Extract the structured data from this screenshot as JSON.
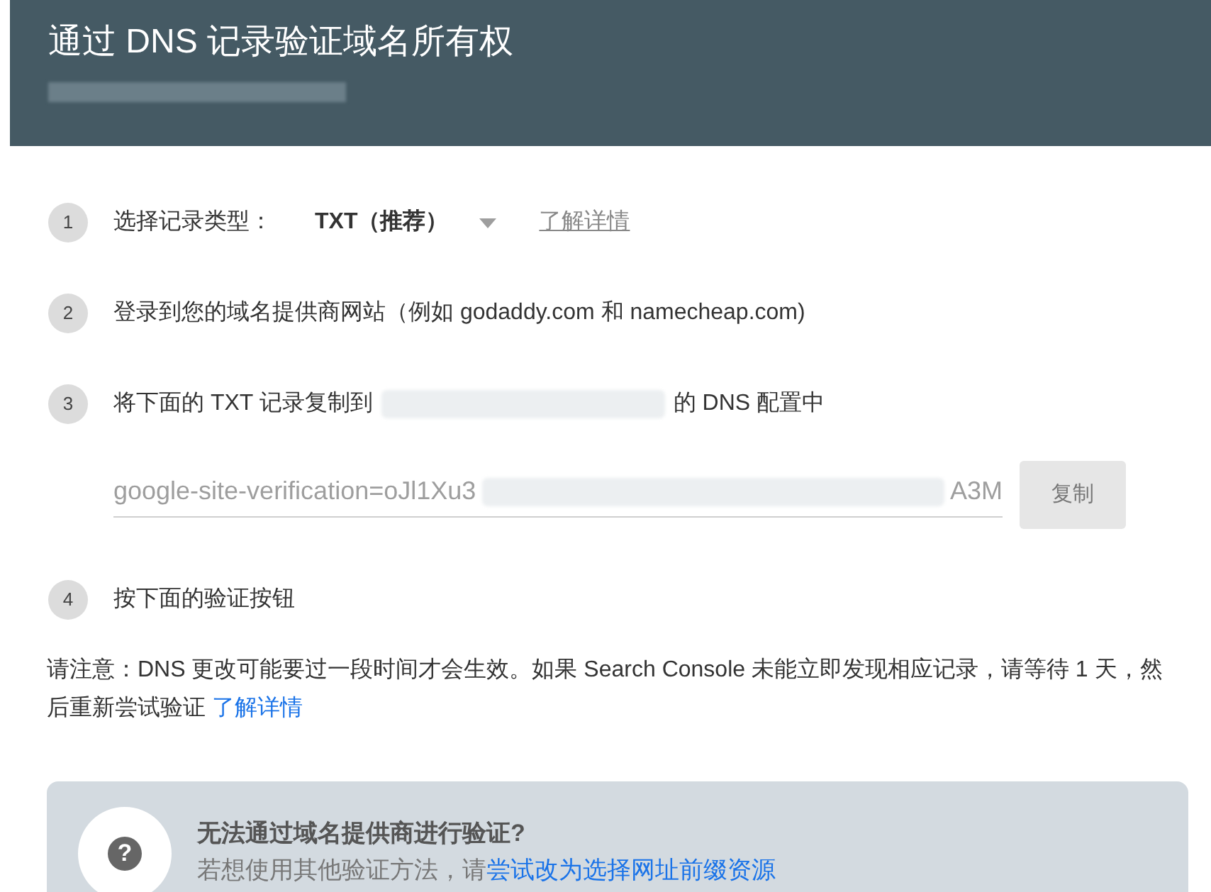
{
  "header": {
    "title": "通过 DNS 记录验证域名所有权"
  },
  "steps": [
    {
      "number": "1",
      "kind": "select",
      "label": "选择记录类型：",
      "value": "TXT（推荐）",
      "link": "了解详情"
    },
    {
      "number": "2",
      "kind": "text",
      "label": "登录到您的域名提供商网站（例如 godaddy.com 和 namecheap.com)"
    },
    {
      "number": "3",
      "kind": "copy",
      "label": "将下面的 TXT 记录复制到",
      "label_end": "的 DNS 配置中",
      "field_start": "google-site-verification=oJl1Xu3",
      "field_end": "A3M",
      "button": "复制"
    },
    {
      "number": "4",
      "kind": "text",
      "label": "按下面的验证按钮"
    }
  ],
  "note": {
    "text": "请注意：DNS 更改可能要过一段时间才会生效。如果 Search Console 未能立即发现相应记录，请等待 1 天，然后重新尝试验证",
    "link": "了解详情"
  },
  "help": {
    "icon": "?",
    "title": "无法通过域名提供商进行验证?",
    "text": "若想使用其他验证方法，请",
    "link": "尝试改为选择网址前缀资源"
  }
}
